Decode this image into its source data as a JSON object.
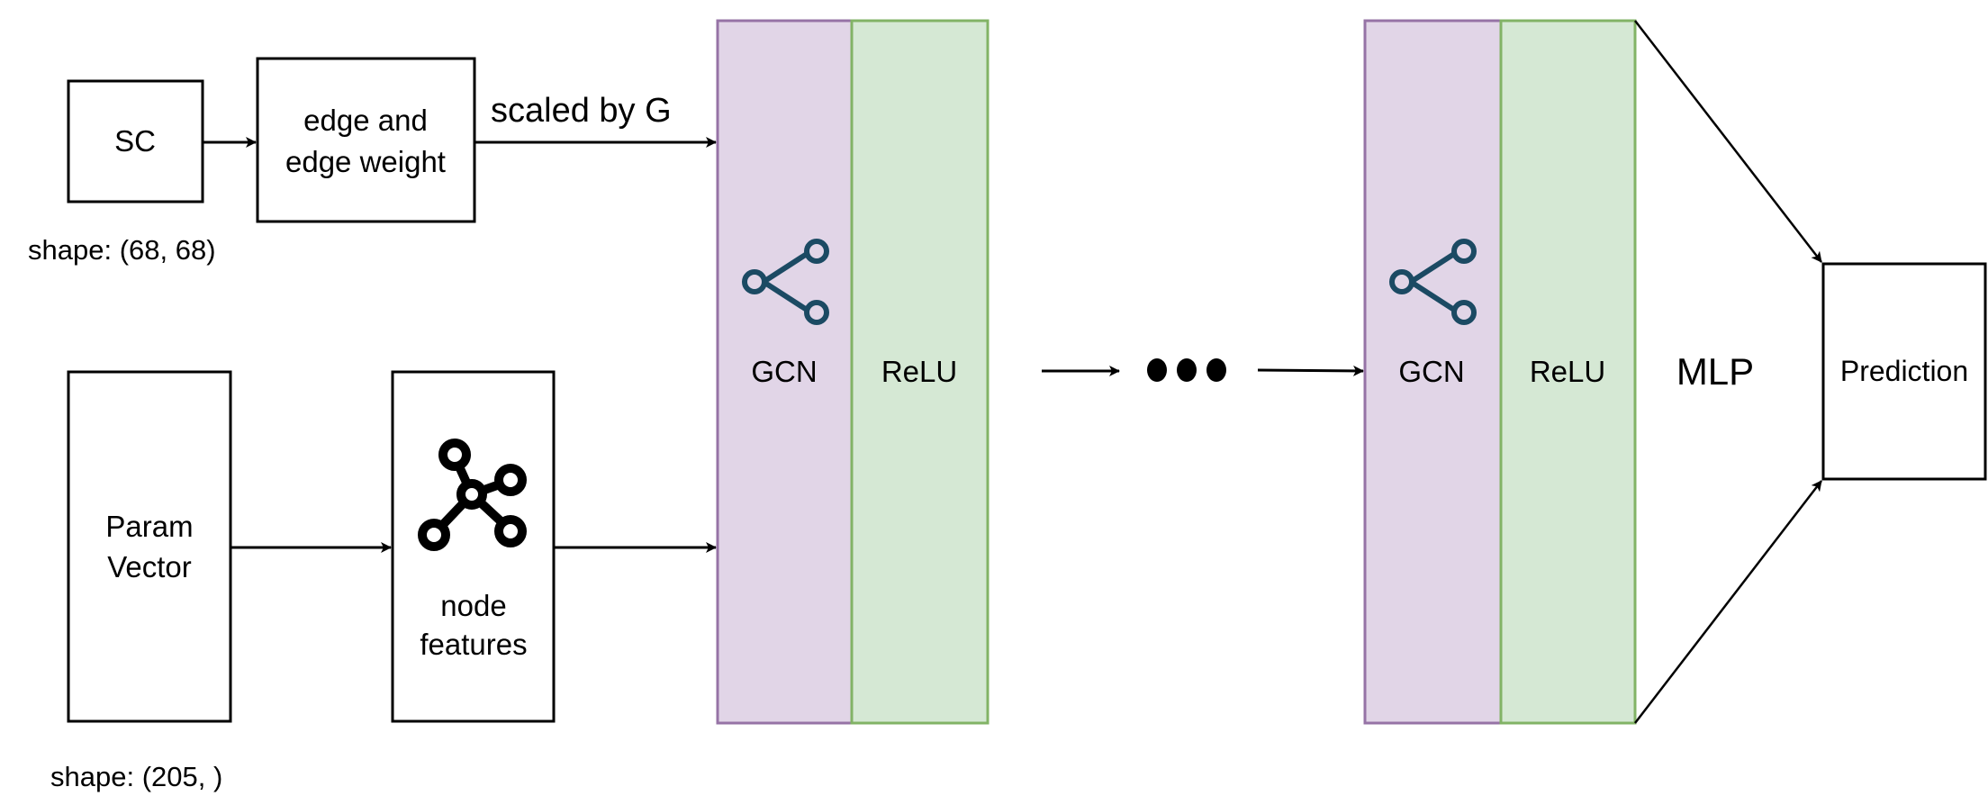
{
  "nodes": {
    "sc": "SC",
    "edge_line1": "edge and",
    "edge_line2": "edge weight",
    "param_line1": "Param",
    "param_line2": "Vector",
    "node_line1": "node",
    "node_line2": "features",
    "gcn1": "GCN",
    "relu1": "ReLU",
    "gcn2": "GCN",
    "relu2": "ReLU",
    "mlp": "MLP",
    "prediction": "Prediction"
  },
  "labels": {
    "scaled": "scaled by G",
    "sc_shape": "shape: (68, 68)",
    "param_shape": "shape: (205, )"
  },
  "colors": {
    "gcn_fill": "#e1d5e7",
    "gcn_stroke": "#9673a6",
    "relu_fill": "#d5e8d4",
    "relu_stroke": "#82b366",
    "icon": "#1b4a63"
  },
  "icons": [
    "share-icon",
    "graph-network-icon"
  ]
}
